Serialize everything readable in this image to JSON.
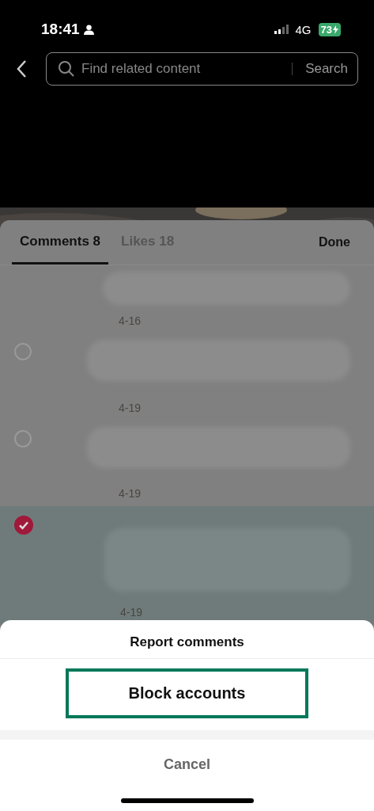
{
  "status_bar": {
    "time": "18:41",
    "network": "4G",
    "battery": "73"
  },
  "search": {
    "placeholder": "Find related content",
    "button": "Search"
  },
  "tabs": [
    {
      "label": "Comments 8",
      "selected": true
    },
    {
      "label": "Likes 18",
      "selected": false
    }
  ],
  "done": "Done",
  "comments": [
    {
      "date": "4-16",
      "selected": false,
      "checkbox_visible": false
    },
    {
      "date": "4-19",
      "selected": false,
      "checkbox_visible": true
    },
    {
      "date": "4-19",
      "selected": false,
      "checkbox_visible": true
    },
    {
      "date": "4-19",
      "selected": true,
      "checkbox_visible": true
    }
  ],
  "action_sheet": {
    "actions": [
      {
        "label": "Report comments",
        "highlighted": false
      },
      {
        "label": "Block accounts",
        "highlighted": true
      }
    ],
    "cancel": "Cancel"
  }
}
